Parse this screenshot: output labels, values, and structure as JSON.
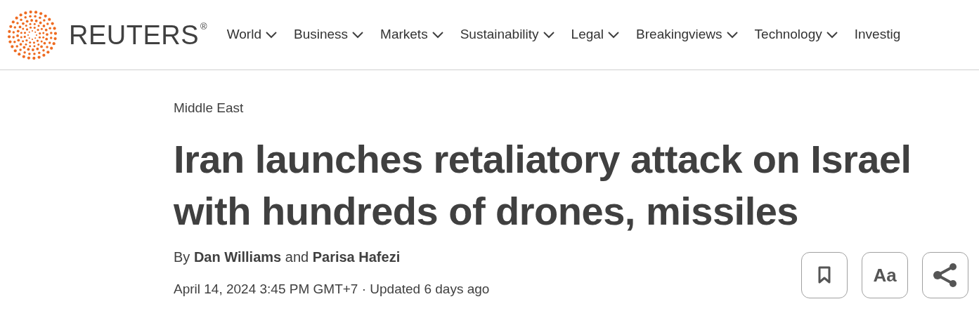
{
  "brand": {
    "name": "REUTERS",
    "mark": "®"
  },
  "nav": [
    {
      "label": "World",
      "caret": true
    },
    {
      "label": "Business",
      "caret": true
    },
    {
      "label": "Markets",
      "caret": true
    },
    {
      "label": "Sustainability",
      "caret": true
    },
    {
      "label": "Legal",
      "caret": true
    },
    {
      "label": "Breakingviews",
      "caret": true
    },
    {
      "label": "Technology",
      "caret": true
    },
    {
      "label": "Investig",
      "caret": false
    }
  ],
  "article": {
    "section": "Middle East",
    "headline": "Iran launches retaliatory attack on Israel with hundreds of drones, missiles",
    "byline": "By **Dan Williams** and **Parisa Hafezi**",
    "dateline": "April 14, 2024 3:45 PM GMT+7 · Updated 6 days ago"
  },
  "actions": [
    {
      "kind": "bookmark"
    },
    {
      "kind": "text",
      "label": "Aa"
    },
    {
      "kind": "share"
    }
  ]
}
